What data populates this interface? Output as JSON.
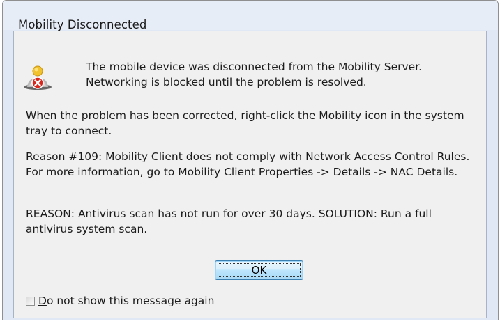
{
  "dialog": {
    "title": "Mobility Disconnected",
    "icon": "user-error-icon",
    "message_1": "The mobile device was disconnected from the Mobility Server. Networking is blocked until the problem is resolved.",
    "message_2": "When the problem has been corrected, right-click the Mobility icon in the system tray to connect.",
    "message_3": "Reason #109: Mobility Client does not comply with Network Access Control Rules. For more information, go to Mobility Client Properties -> Details -> NAC Details.",
    "message_4": "REASON: Antivirus scan has not run for over 30 days. SOLUTION: Run a full antivirus system scan.",
    "ok_label": "OK",
    "checkbox_label": "Do not show this message again",
    "checkbox_checked": false
  },
  "colors": {
    "title_bar": "#e6edf7",
    "client": "#f0f0f0",
    "button_border": "#3c7fb1",
    "error_red": "#d9261c"
  }
}
